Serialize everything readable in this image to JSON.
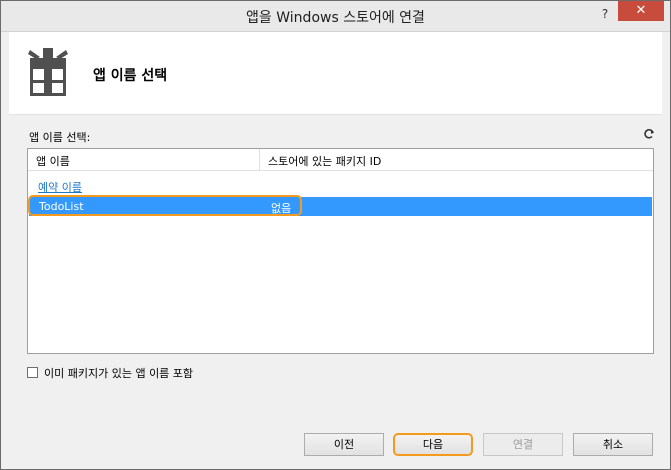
{
  "window": {
    "title": "앱을 Windows 스토어에 연결",
    "help_label": "?",
    "close_label": "✕"
  },
  "header": {
    "title": "앱 이름 선택",
    "icon": "gift-box-icon"
  },
  "list": {
    "label": "앱 이름 선택:",
    "refresh_icon": "refresh-icon",
    "columns": [
      "앱 이름",
      "스토어에 있는 패키지 ID"
    ],
    "reserve_link": "예약 이름",
    "rows": [
      {
        "name": "TodoList",
        "package": "없음",
        "selected": true
      }
    ]
  },
  "options": {
    "include_existing_label": "이미 패키지가 있는 앱 이름 포함",
    "include_existing_checked": false
  },
  "buttons": {
    "prev": "이전",
    "next": "다음",
    "connect": "연결",
    "cancel": "취소"
  },
  "colors": {
    "selection": "#3399ff",
    "link": "#1e78c8",
    "highlight": "#f39a1f",
    "close": "#c74c3c"
  }
}
